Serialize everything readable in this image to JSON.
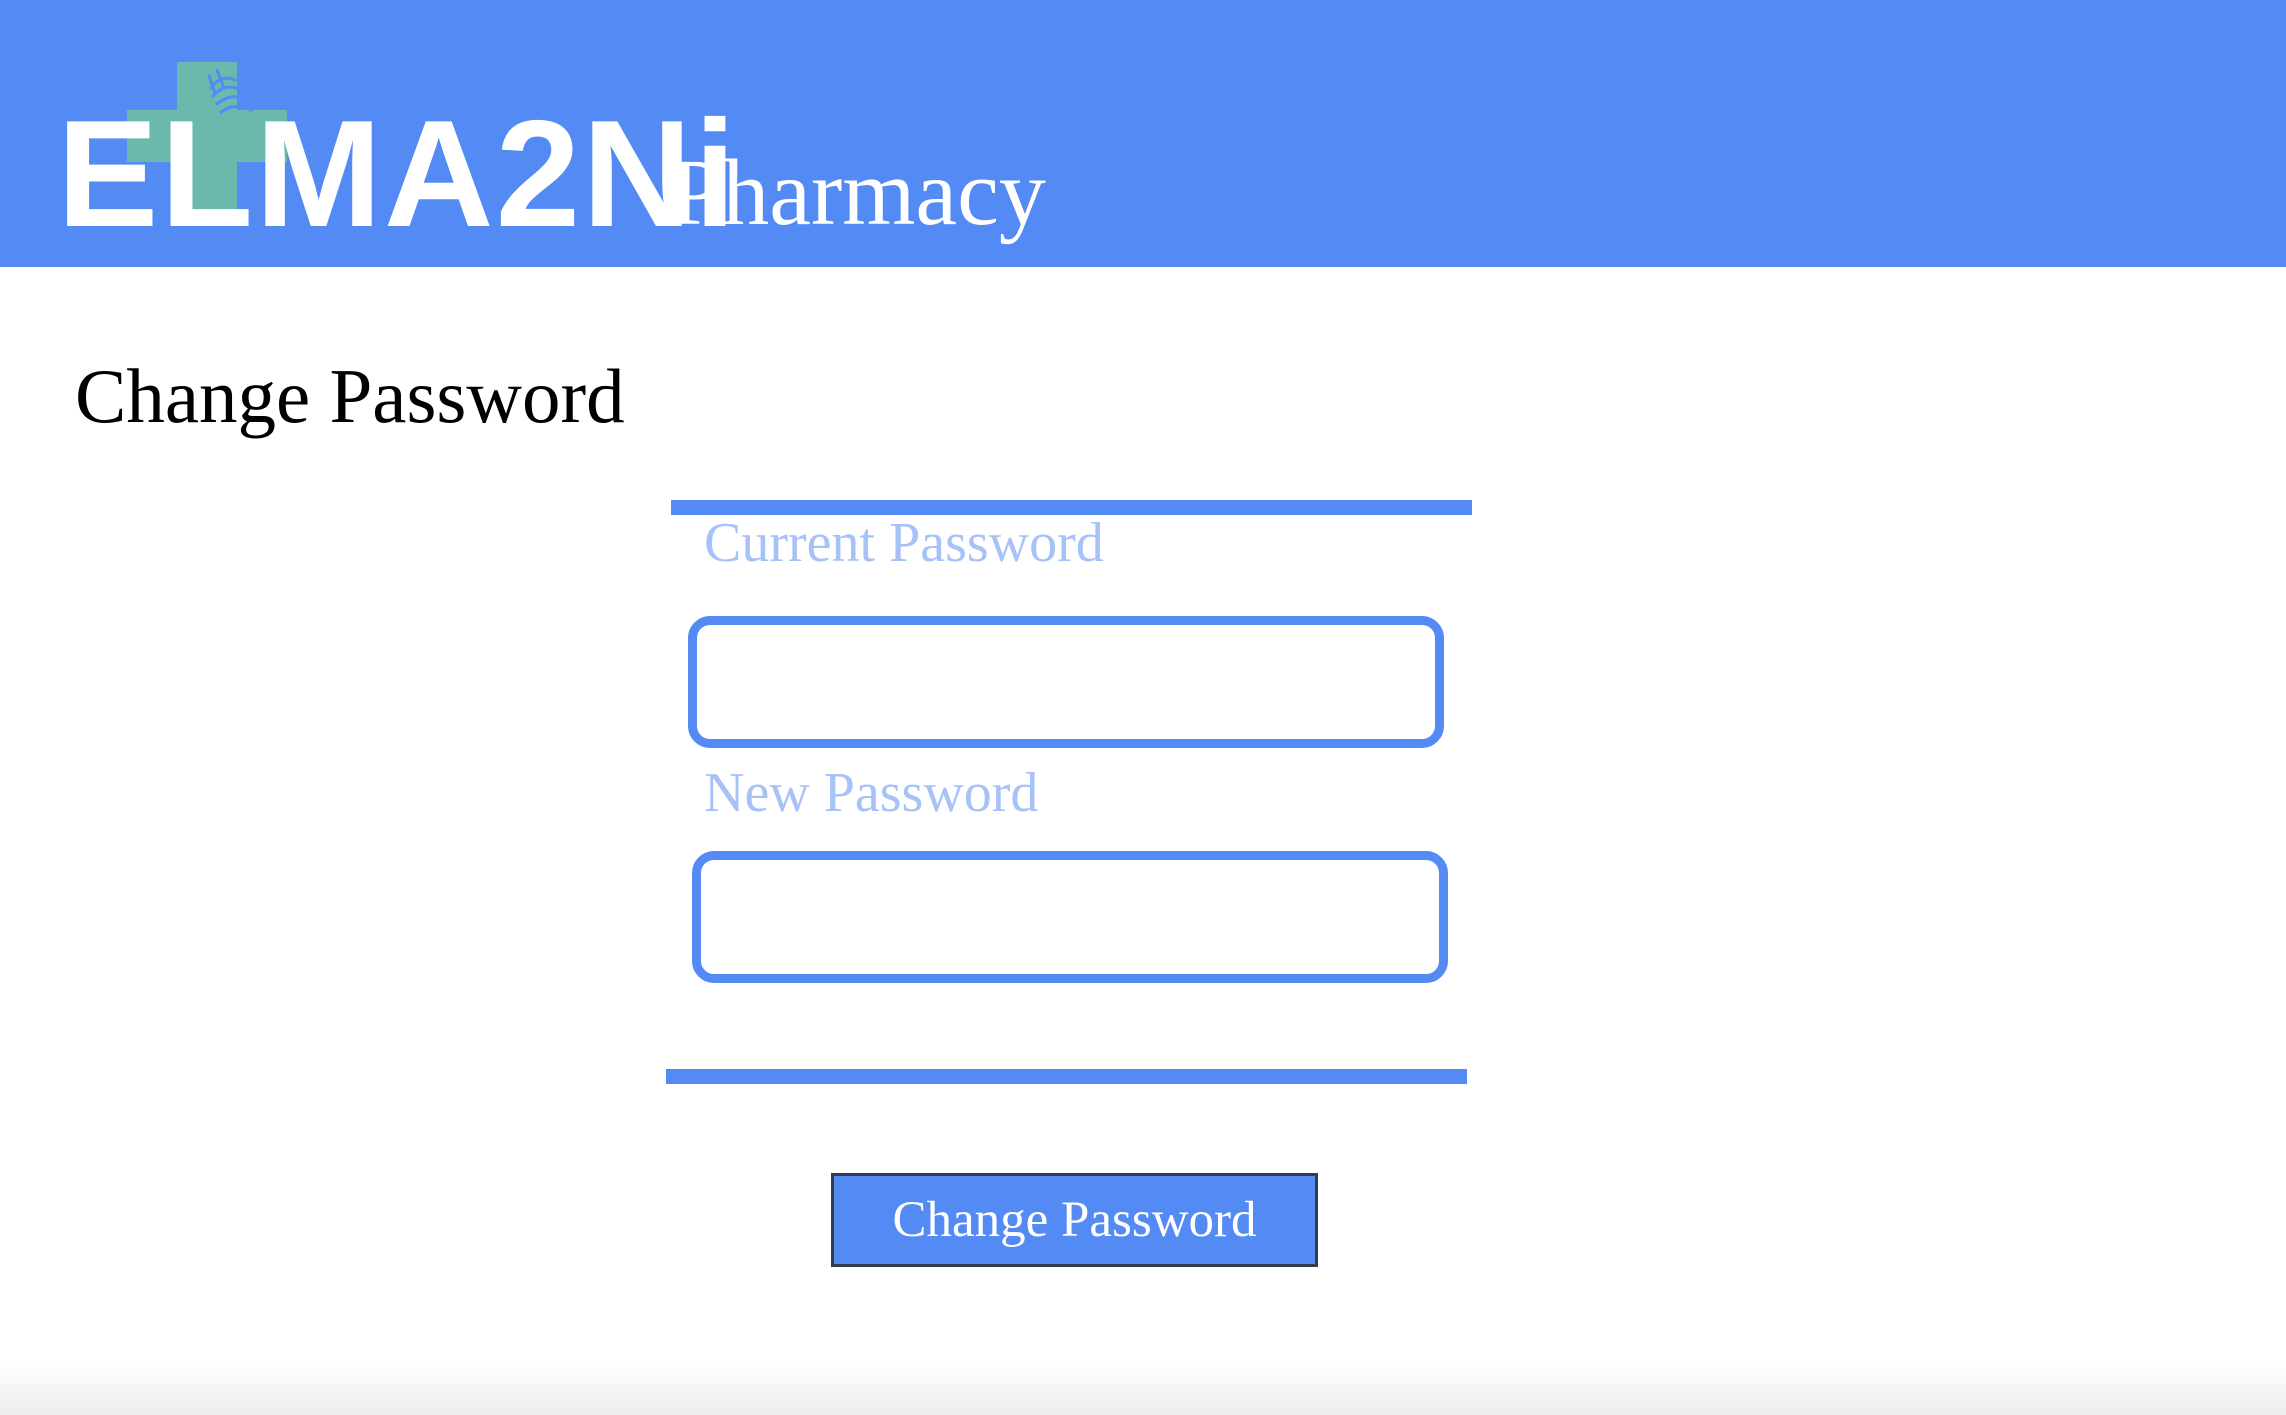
{
  "header": {
    "logo_text": "ELMA2Ni",
    "brand_subtitle": "Pharmacy",
    "logo_icon": "pharmacy-cross-hands-icon"
  },
  "page": {
    "title": "Change Password"
  },
  "form": {
    "current_password": {
      "label": "Current Password",
      "value": "",
      "placeholder": ""
    },
    "new_password": {
      "label": "New Password",
      "value": "",
      "placeholder": ""
    },
    "submit_label": "Change Password"
  },
  "colors": {
    "header_background": "#548af4",
    "field_label": "#a7c2f7",
    "logo_cross": "#6bb8ad",
    "button_background": "#548af4",
    "button_text": "#ffffff"
  }
}
